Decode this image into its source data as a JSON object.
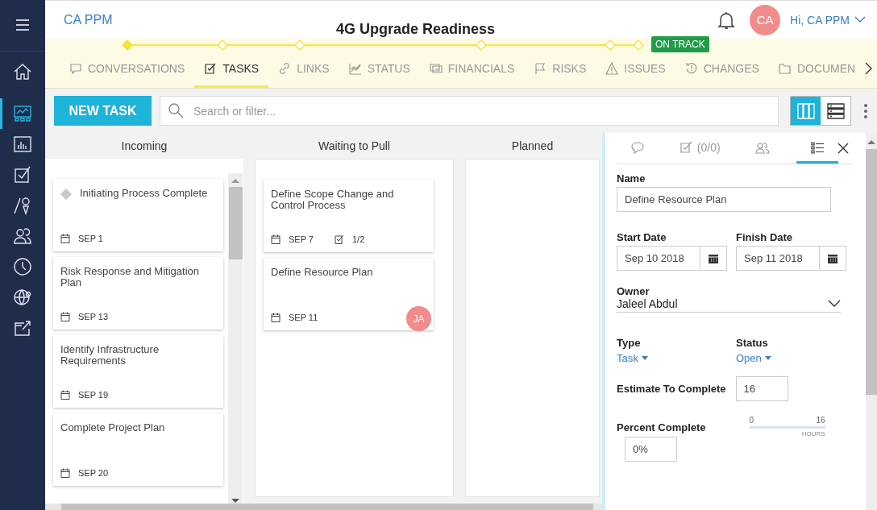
{
  "header": {
    "brand": "CA PPM",
    "title": "4G Upgrade Readiness",
    "user": {
      "initials": "CA",
      "greeting": "Hi, CA PPM"
    }
  },
  "progress": {
    "milestones": [
      {
        "reached": true
      },
      {
        "reached": false
      },
      {
        "reached": false
      },
      {
        "reached": false
      },
      {
        "reached": false
      },
      {
        "reached": false
      }
    ],
    "badge": "ON TRACK"
  },
  "tabs": [
    {
      "label": "CONVERSATIONS",
      "selected": false
    },
    {
      "label": "TASKS",
      "selected": true
    },
    {
      "label": "LINKS",
      "selected": false
    },
    {
      "label": "STATUS",
      "selected": false
    },
    {
      "label": "FINANCIALS",
      "selected": false
    },
    {
      "label": "RISKS",
      "selected": false
    },
    {
      "label": "ISSUES",
      "selected": false
    },
    {
      "label": "CHANGES",
      "selected": false
    },
    {
      "label": "DOCUMEN",
      "selected": false
    }
  ],
  "sidebar": {
    "items": [
      {
        "kind": "home",
        "selected": false
      },
      {
        "kind": "dashboard",
        "selected": true
      },
      {
        "kind": "bars",
        "selected": false
      },
      {
        "kind": "check",
        "selected": false
      },
      {
        "kind": "pin",
        "selected": false
      },
      {
        "kind": "people",
        "selected": false
      },
      {
        "kind": "clock",
        "selected": false
      },
      {
        "kind": "globe",
        "selected": false
      },
      {
        "kind": "export",
        "selected": false
      }
    ]
  },
  "toolbar": {
    "new_button": "NEW TASK",
    "search": {
      "placeholder": "Search or filter..."
    },
    "views": [
      {
        "kind": "columns",
        "selected": true
      },
      {
        "kind": "list",
        "selected": false
      }
    ]
  },
  "board": {
    "columns": [
      {
        "title": "Incoming",
        "cards": [
          {
            "kind": "milestone",
            "title": "Initiating Process Complete",
            "date": "SEP 1"
          },
          {
            "kind": "task",
            "title": "Risk Response and Mitigation Plan",
            "date": "SEP 13"
          },
          {
            "kind": "task",
            "title": "Identify Infrastructure Requirements",
            "date": "SEP 19"
          },
          {
            "kind": "task",
            "title": "Complete Project Plan",
            "date": "SEP 20"
          }
        ]
      },
      {
        "title": "Waiting to Pull",
        "cards": [
          {
            "kind": "task",
            "title": "Define Scope Change and Control Process",
            "date": "SEP 7",
            "checklist": "1/2"
          },
          {
            "kind": "task",
            "title": "Define Resource Plan",
            "date": "SEP 11",
            "owner": "JA"
          }
        ]
      },
      {
        "title": "Planned"
      }
    ]
  },
  "details": {
    "tabs": [
      {
        "kind": "comments",
        "selected": false
      },
      {
        "kind": "checklist",
        "label": "(0/0)",
        "selected": false
      },
      {
        "kind": "team",
        "selected": false
      },
      {
        "kind": "properties",
        "selected": true
      }
    ],
    "name": {
      "label": "Name",
      "value": "Define Resource Plan"
    },
    "start_date": {
      "label": "Start Date",
      "value": "Sep 10 2018"
    },
    "finish_date": {
      "label": "Finish Date",
      "value": "Sep 11 2018"
    },
    "owner": {
      "label": "Owner",
      "value": "Jaleel Abdul"
    },
    "type": {
      "label": "Type",
      "value": "Task"
    },
    "status": {
      "label": "Status",
      "value": "Open"
    },
    "estimate": {
      "label": "Estimate To Complete",
      "value": "16"
    },
    "percent": {
      "label": "Percent Complete",
      "value": "0%",
      "slider": {
        "min": "0",
        "max": "16",
        "unit": "HOURS"
      }
    }
  }
}
